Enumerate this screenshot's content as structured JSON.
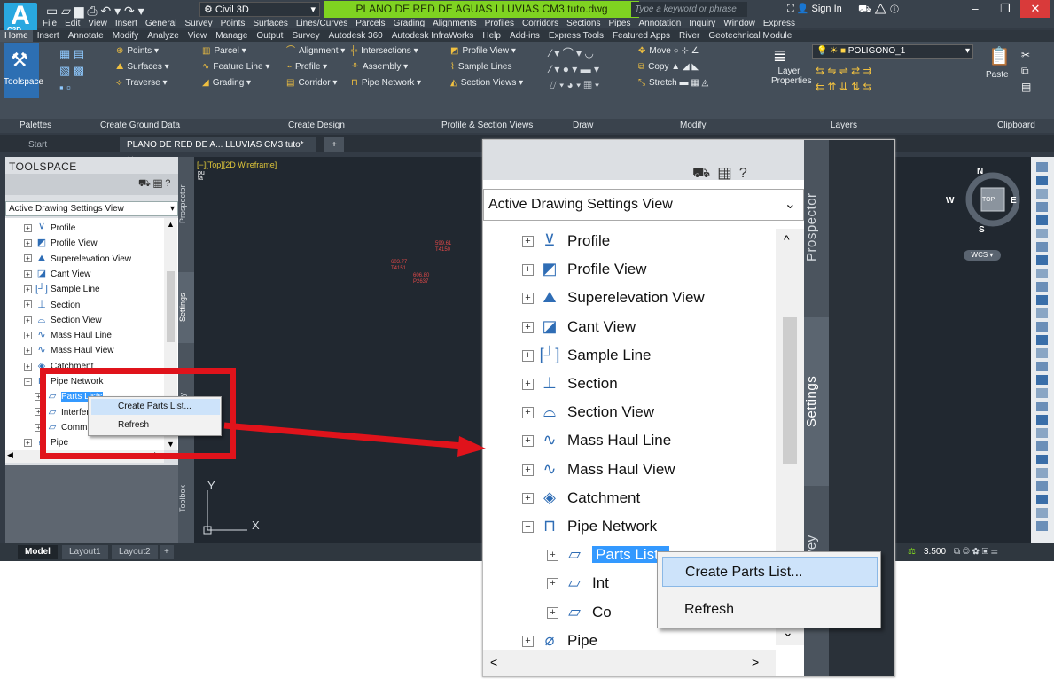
{
  "app": {
    "logo": "A",
    "logo_sub": "C3D",
    "workspace": "Civil 3D",
    "doc_title": "PLANO DE RED DE AGUAS LLUVIAS CM3 tuto.dwg",
    "search_placeholder": "Type a keyword or phrase",
    "sign_in": "Sign In"
  },
  "menu": [
    "File",
    "Edit",
    "View",
    "Insert",
    "General",
    "Survey",
    "Points",
    "Surfaces",
    "Lines/Curves",
    "Parcels",
    "Grading",
    "Alignments",
    "Profiles",
    "Corridors",
    "Sections",
    "Pipes",
    "Annotation",
    "Inquiry",
    "Window",
    "Express"
  ],
  "ribbon_tabs": [
    "Home",
    "Insert",
    "Annotate",
    "Modify",
    "Analyze",
    "View",
    "Manage",
    "Output",
    "Survey",
    "Autodesk 360",
    "Autodesk InfraWorks",
    "Help",
    "Add-ins",
    "Express Tools",
    "Featured Apps",
    "River",
    "Geotechnical Module"
  ],
  "ribbon": {
    "toolspace": "Toolspace",
    "points": "Points",
    "surfaces": "Surfaces",
    "traverse": "Traverse",
    "parcel": "Parcel",
    "feature_line": "Feature Line",
    "grading": "Grading",
    "alignment": "Alignment",
    "profile": "Profile",
    "corridor": "Corridor",
    "intersections": "Intersections",
    "assembly": "Assembly",
    "pipe_network": "Pipe Network",
    "profile_view": "Profile View",
    "sample_lines": "Sample Lines",
    "section_views": "Section Views",
    "move": "Move",
    "copy": "Copy",
    "stretch": "Stretch",
    "layer_properties": "Layer Properties",
    "layer_name": "POLIGONO_1",
    "paste": "Paste"
  },
  "ribbon_panels": [
    "Palettes",
    "Create Ground Data",
    "Create Design",
    "Profile & Section Views",
    "Draw",
    "Modify",
    "Layers",
    "Clipboard"
  ],
  "doc_tabs": [
    "Start",
    "PLANO DE RED DE A... LLUVIAS CM3 tuto*"
  ],
  "toolspace": {
    "title": "TOOLSPACE",
    "view": "Active Drawing Settings View",
    "side_tabs": [
      "Prospector",
      "Settings",
      "Survey",
      "Toolbox"
    ],
    "items": [
      "Profile",
      "Profile View",
      "Superelevation View",
      "Cant View",
      "Sample Line",
      "Section",
      "Section View",
      "Mass Haul Line",
      "Mass Haul View",
      "Catchment",
      "Pipe Network",
      "Parts Lists",
      "Interference Check",
      "Commands",
      "Pipe"
    ]
  },
  "context_menu": {
    "create": "Create Parts List...",
    "refresh": "Refresh"
  },
  "zoom": {
    "view": "Active Drawing Settings View",
    "side_tabs": [
      "Prospector",
      "Settings",
      "Survey"
    ],
    "items": [
      "Profile",
      "Profile View",
      "Superelevation View",
      "Cant View",
      "Sample Line",
      "Section",
      "Section View",
      "Mass Haul Line",
      "Mass Haul View",
      "Catchment",
      "Pipe Network",
      "Parts Lists",
      "Int",
      "Co",
      "Pipe"
    ]
  },
  "canvas": {
    "view_label": "[−][Top][2D Wireframe]",
    "points": [
      "599.61",
      "T4150",
      "603.77",
      "T4151",
      "606.80",
      "P2637"
    ],
    "ucs_x": "X",
    "ucs_y": "Y"
  },
  "compass": {
    "n": "N",
    "s": "S",
    "e": "E",
    "w": "W",
    "top": "TOP",
    "wcs": "WCS"
  },
  "layouts": [
    "Model",
    "Layout1",
    "Layout2"
  ],
  "status": {
    "scale": "3.500"
  },
  "colors": {
    "accent": "#29a8e0",
    "highlight": "#3399ff",
    "title_green": "#7fd321",
    "callout": "#e0131b"
  }
}
